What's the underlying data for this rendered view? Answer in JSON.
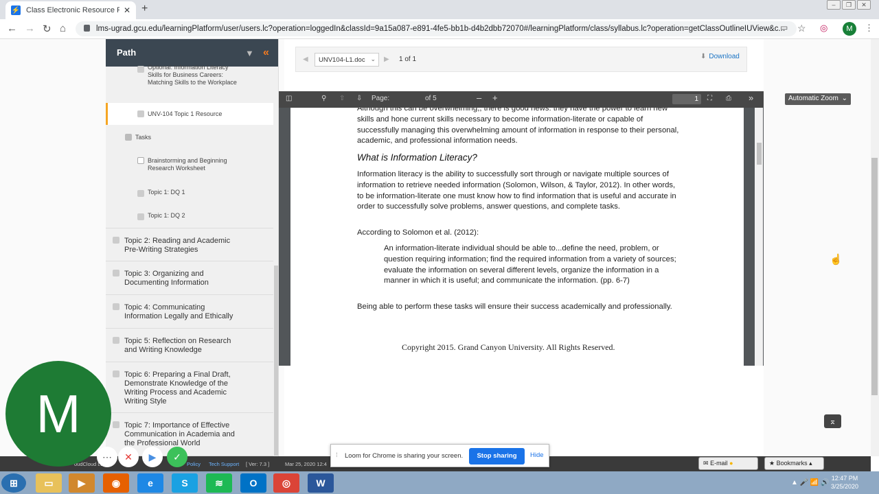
{
  "browser": {
    "tab_title": "Class Electronic Resource Previe",
    "url": "lms-ugrad.gcu.edu/learningPlatform/user/users.lc?operation=loggedIn&classId=9a15a087-e891-4fe5-bb1b-d4b2dbb72070#/learningPlatform/class/syllabus.lc?operation=getClassOutlineIUView&c...",
    "profile_initial": "M"
  },
  "sidebar": {
    "title": "Path",
    "items": [
      {
        "label": "Optional: Information Literacy Skills for Business Careers: Matching Skills to the Workplace"
      },
      {
        "label": "UNV-104 Topic 1 Resource"
      },
      {
        "label": "Tasks"
      },
      {
        "label": "Brainstorming and Beginning Research Worksheet"
      },
      {
        "label": "Topic 1: DQ 1"
      },
      {
        "label": "Topic 1: DQ 2"
      }
    ],
    "topics": [
      {
        "label": "Topic 2: Reading and Academic Pre-Writing Strategies"
      },
      {
        "label": "Topic 3: Organizing and Documenting Information"
      },
      {
        "label": "Topic 4: Communicating Information Legally and Ethically"
      },
      {
        "label": "Topic 5: Reflection on Research and Writing Knowledge"
      },
      {
        "label": "Topic 6: Preparing a Final Draft, Demonstrate Knowledge of the Writing Process and Academic Writing Style"
      },
      {
        "label": "Topic 7: Importance of Effective Communication in Academia and the Professional World"
      }
    ]
  },
  "docbar": {
    "file": "UNV104-L1.doc",
    "page_count": "1 of 1",
    "download": "Download"
  },
  "pdf": {
    "page_label": "Page:",
    "page_value": "1",
    "page_of": "of 5",
    "zoom": "Automatic Zoom",
    "para1": "Although this can be overwhelming,, there is good news: they have the power to learn new skills and hone current skills necessary to become information-literate or capable of successfully managing this overwhelming amount of information in response to their personal, academic, and professional information needs.",
    "heading": "What is Information Literacy?",
    "para2": "Information literacy is the ability to successfully sort through or navigate multiple sources of information to retrieve needed information (Solomon, Wilson, & Taylor, 2012). In other words, to be information-literate one must know how to find information that is useful and accurate in order to successfully solve problems, answer questions, and complete tasks.",
    "para3": "According to Solomon et al. (2012):",
    "quote": "An information-literate individual should be able to...define the need, problem, or question requiring information; find the required information from a variety of sources; evaluate the information on several different levels, organize the information in a manner in which it is useful; and communicate the information. (pp. 6-7)",
    "para4": "Being able to perform these tasks will ensure their success academically and professionally.",
    "copyright": "Copyright 2015. Grand Canyon University. All Rights Reserved."
  },
  "loom": {
    "avatar_initial": "M",
    "message": "Loom for Chrome is sharing your screen.",
    "stop": "Stop sharing",
    "hide": "Hide"
  },
  "footer": {
    "company": "oudCloud LLC",
    "policy": "Policy",
    "support": "Tech Support",
    "version": "[ Ver: 7.3 ]",
    "date": "Mar 25, 2020  12:4",
    "email": "E-mail",
    "bookmarks": "Bookmarks"
  },
  "clock": {
    "time": "12:47 PM",
    "date": "3/25/2020"
  }
}
